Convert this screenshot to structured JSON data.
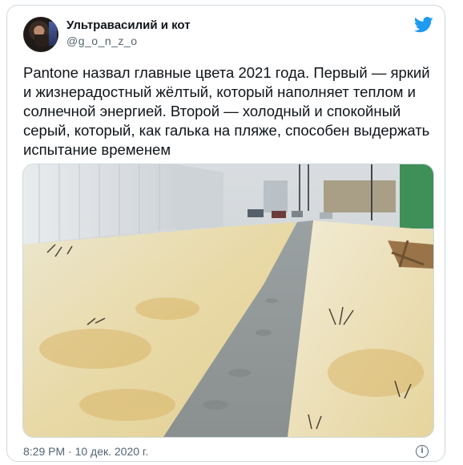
{
  "tweet": {
    "display_name": "Ультравасилий и кот",
    "handle": "@g_o_n_z_o",
    "text": "Pantone назвал главные цвета 2021 года. Первый — яркий и жизнерадостный жёлтый, который наполняет теплом и солнечной энергией. Второй — холодный и спокойный серый, который, как галька на пляже, способен выдержать испытание временем",
    "timestamp": "8:29 PM · 10 дек. 2020 г.",
    "info_icon": "info-icon",
    "brand_icon": "twitter-bird-icon"
  },
  "colors": {
    "accent": "#1d9bf0",
    "text_primary": "#0f1419",
    "text_secondary": "#536471",
    "border": "#cfd9de"
  },
  "media": {
    "description_icon": "photo"
  }
}
